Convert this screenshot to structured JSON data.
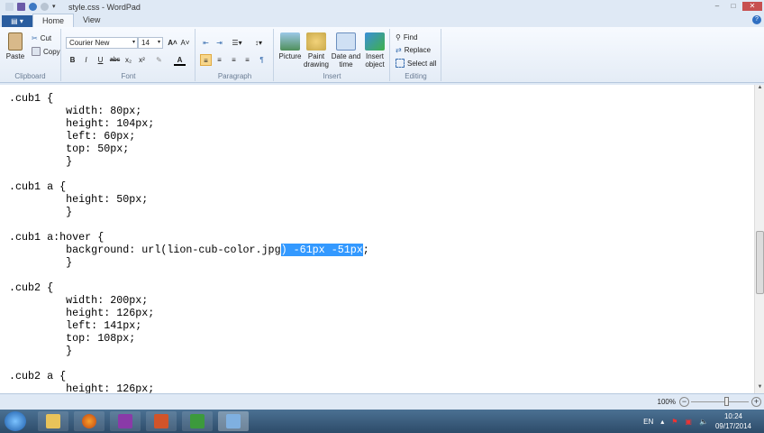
{
  "window": {
    "title": "style.css - WordPad",
    "min": "–",
    "max": "□",
    "close": "✕"
  },
  "tabs": {
    "file": "▤ ▾",
    "home": "Home",
    "view": "View"
  },
  "ribbon": {
    "clipboard": {
      "label": "Clipboard",
      "paste": "Paste",
      "cut": "Cut",
      "copy": "Copy"
    },
    "font": {
      "label": "Font",
      "family": "Courier New",
      "size": "14",
      "bold": "B",
      "italic": "I",
      "underline": "U",
      "strike": "abc",
      "sub": "x₂",
      "sup": "x²",
      "grow": "A˄",
      "shrink": "A˅",
      "color": "A"
    },
    "paragraph": {
      "label": "Paragraph"
    },
    "insert": {
      "label": "Insert",
      "picture": "Picture",
      "paint": "Paint drawing",
      "datetime": "Date and time",
      "object": "Insert object"
    },
    "editing": {
      "label": "Editing",
      "find": "Find",
      "replace": "Replace",
      "selectall": "Select all"
    }
  },
  "document": {
    "lines": [
      ".cub1 {",
      "\twidth: 80px;",
      "\theight: 104px;",
      "\tleft: 60px;",
      "\ttop: 50px;",
      "\t}",
      "",
      ".cub1 a {",
      "\theight: 50px;",
      "\t}",
      "",
      ".cub1 a:hover {"
    ],
    "hover_line": {
      "before": "\tbackground: url(lion-cub-color.jpg",
      "selected": ") -61px -51px",
      "after": ";"
    },
    "lines2": [
      "\t}",
      "",
      ".cub2 {",
      "\twidth: 200px;",
      "\theight: 126px;",
      "\tleft: 141px;",
      "\ttop: 108px;",
      "\t}",
      "",
      ".cub2 a {",
      "\theight: 126px;"
    ]
  },
  "status": {
    "zoom": "100%",
    "zoom_out": "−",
    "zoom_in": "+",
    "zoom_fraction": 1.0
  },
  "taskbar": {
    "lang": "EN",
    "time": "10:24",
    "date": "09/17/2014"
  },
  "colors": {
    "selection": "#3399ff",
    "accent": "#2a5d9f"
  }
}
